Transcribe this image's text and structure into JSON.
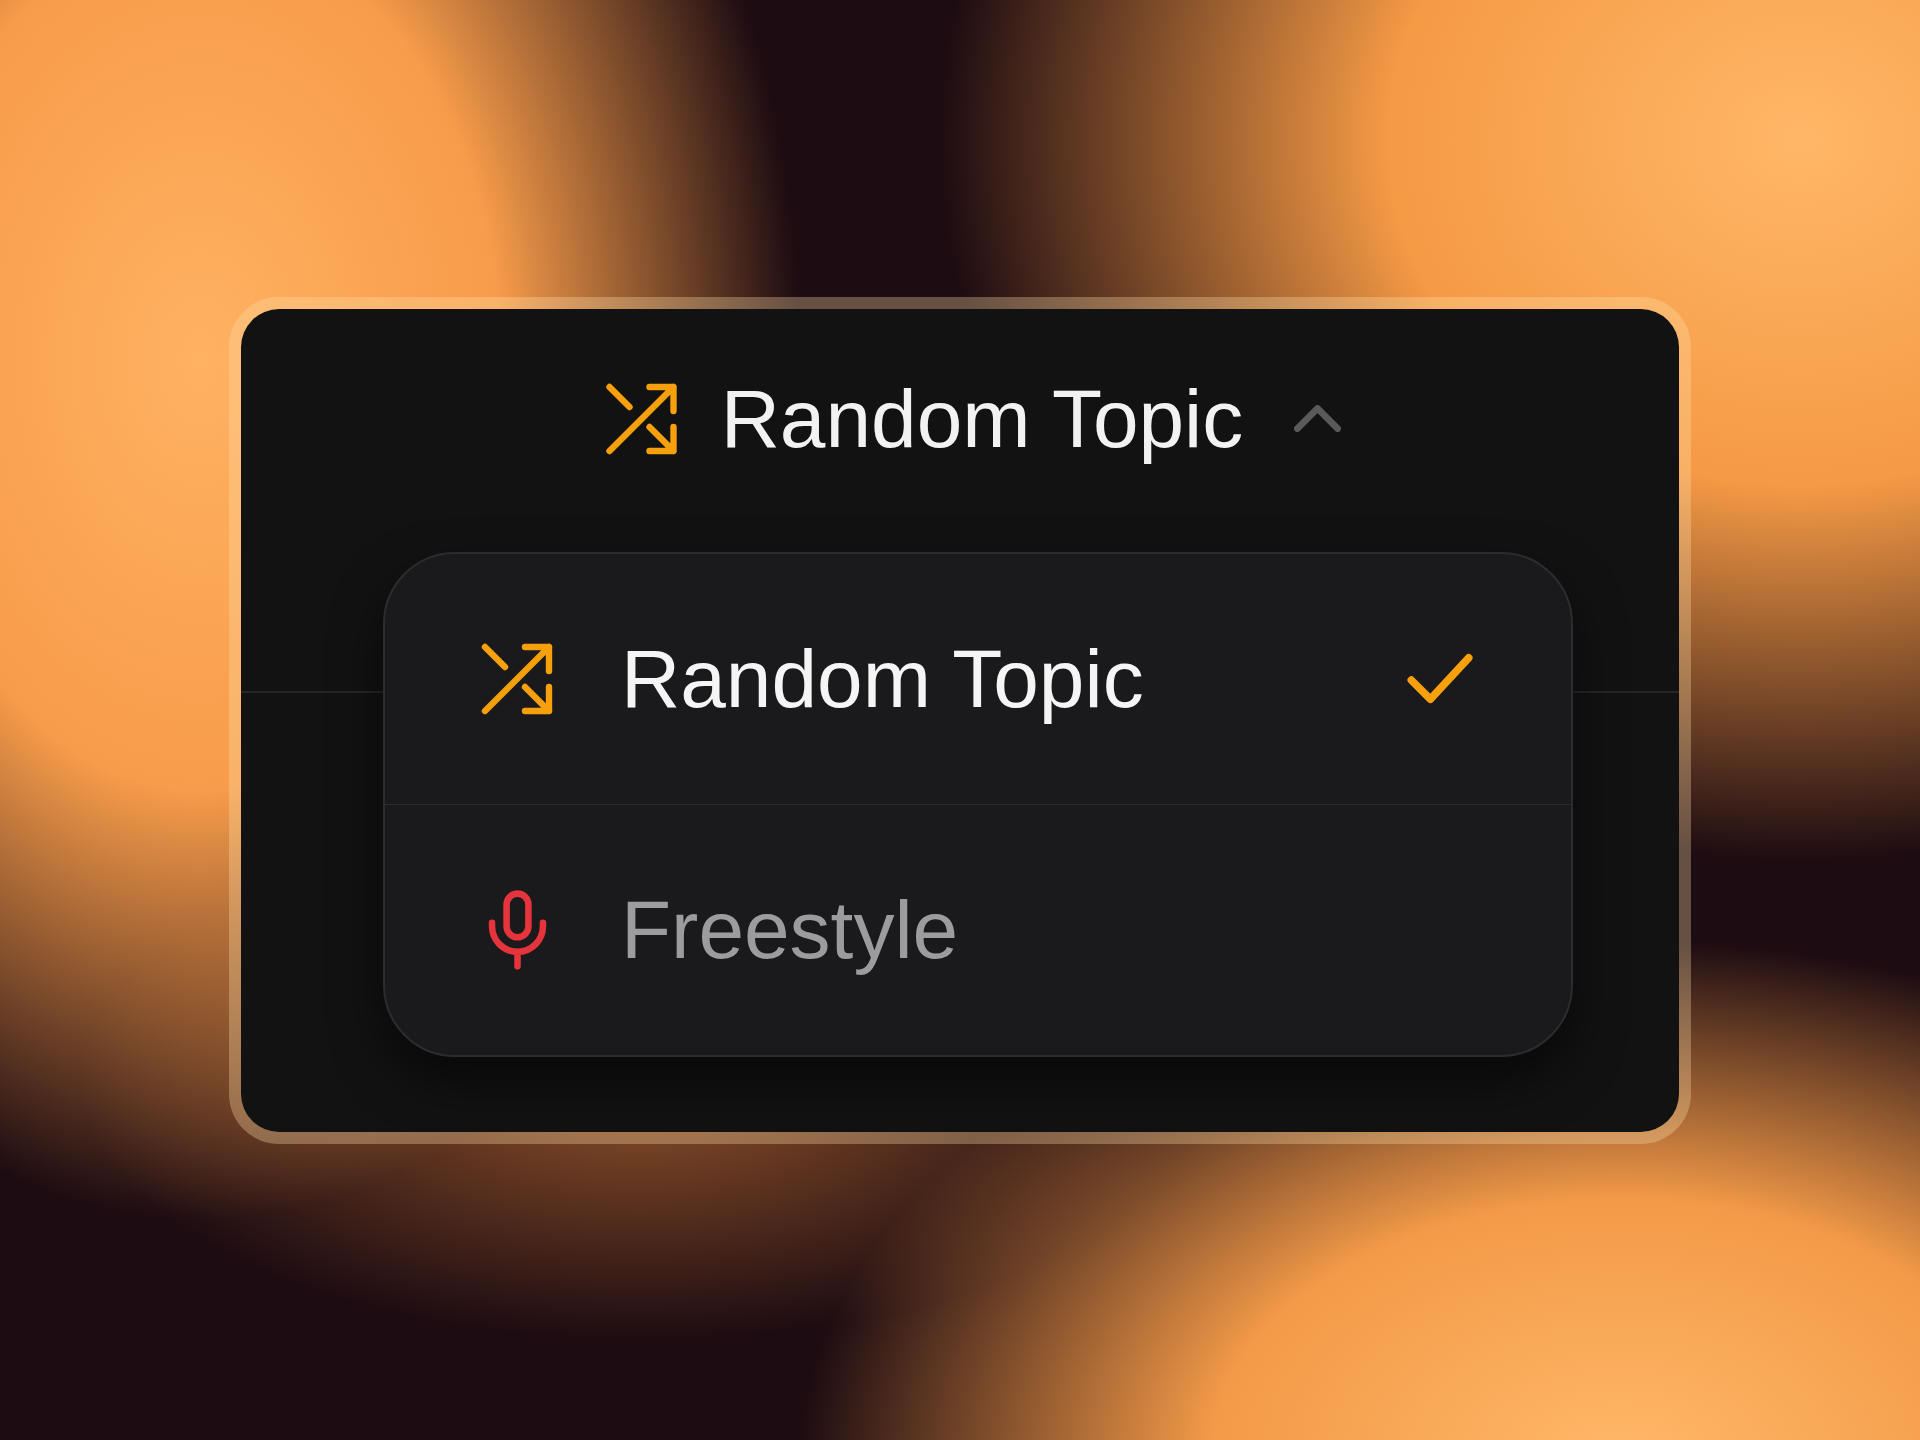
{
  "trigger": {
    "label": "Random Topic"
  },
  "dropdown": {
    "expanded": true,
    "items": [
      {
        "kind": "shuffle",
        "label": "Random Topic",
        "selected": true
      },
      {
        "kind": "mic",
        "label": "Freestyle",
        "selected": false
      }
    ]
  }
}
